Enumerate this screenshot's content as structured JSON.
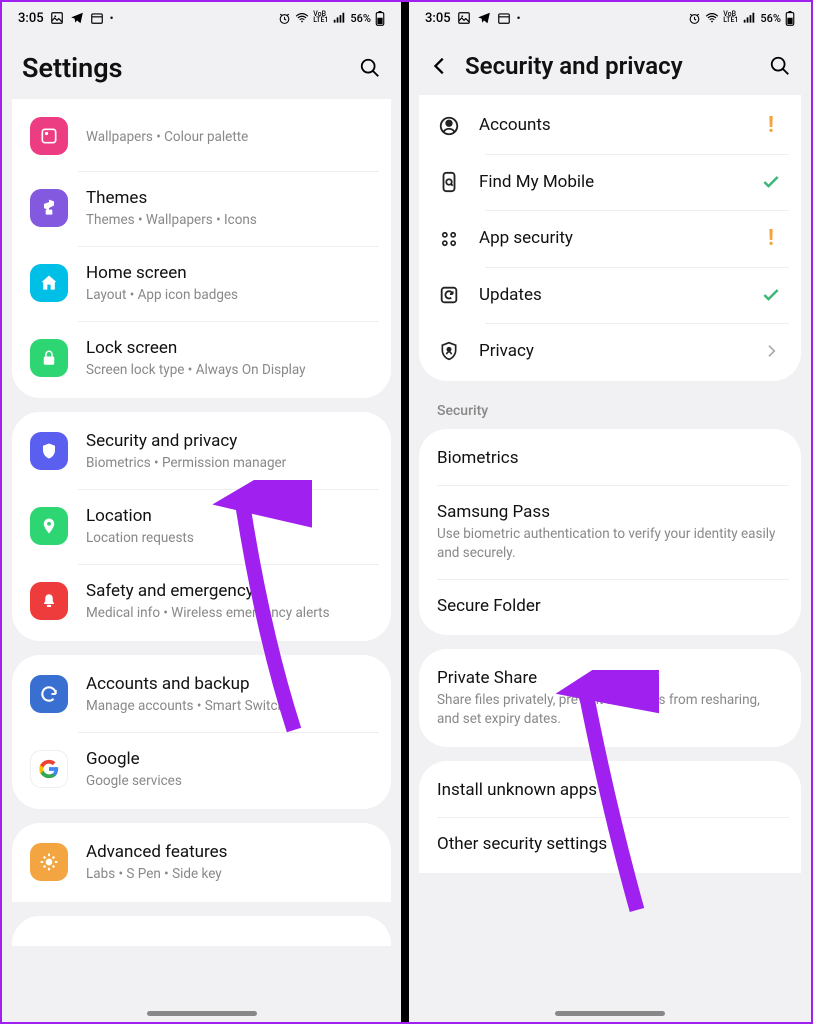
{
  "status_bar": {
    "time": "3:05",
    "battery": "56%"
  },
  "left": {
    "title": "Settings",
    "groups": [
      {
        "cut": "top",
        "items": [
          {
            "icon": "wallpaper-icon",
            "color": "#ec3d82",
            "title": "",
            "sub": "Wallpapers  •  Colour palette"
          },
          {
            "icon": "themes-icon",
            "color": "#8359e0",
            "title": "Themes",
            "sub": "Themes  •  Wallpapers  •  Icons"
          },
          {
            "icon": "home-icon",
            "color": "#00bfe6",
            "title": "Home screen",
            "sub": "Layout  •  App icon badges"
          },
          {
            "icon": "lock-icon",
            "color": "#2ed573",
            "title": "Lock screen",
            "sub": "Screen lock type  •  Always On Display"
          }
        ]
      },
      {
        "items": [
          {
            "icon": "shield-icon",
            "color": "#5b5ff0",
            "title": "Security and privacy",
            "sub": "Biometrics  •  Permission manager"
          },
          {
            "icon": "location-pin-icon",
            "color": "#2ed573",
            "title": "Location",
            "sub": "Location requests"
          },
          {
            "icon": "emergency-icon",
            "color": "#ee3c3c",
            "title": "Safety and emergency",
            "sub": "Medical info  •  Wireless emergency alerts"
          }
        ]
      },
      {
        "items": [
          {
            "icon": "sync-icon",
            "color": "#3a6fd2",
            "title": "Accounts and backup",
            "sub": "Manage accounts  •  Smart Switch"
          },
          {
            "icon": "google-icon",
            "color": "#ffffff",
            "title": "Google",
            "sub": "Google services"
          }
        ]
      },
      {
        "cut": "bottom",
        "items": [
          {
            "icon": "star-icon",
            "color": "#f2a540",
            "title": "Advanced features",
            "sub": "Labs  •  S Pen  •  Side key"
          }
        ]
      }
    ]
  },
  "right": {
    "title": "Security and privacy",
    "top_group": {
      "cut": "top",
      "items": [
        {
          "icon": "account-icon",
          "title": "Accounts",
          "tail": "alert"
        },
        {
          "icon": "find-phone-icon",
          "title": "Find My Mobile",
          "tail": "check"
        },
        {
          "icon": "grid-icon",
          "title": "App security",
          "tail": "alert"
        },
        {
          "icon": "update-icon",
          "title": "Updates",
          "tail": "check"
        },
        {
          "icon": "privacy-shield-icon",
          "title": "Privacy",
          "tail": "chev"
        }
      ]
    },
    "section_label": "Security",
    "sec_group1": {
      "items": [
        {
          "title": "Biometrics",
          "sub": ""
        },
        {
          "title": "Samsung Pass",
          "sub": "Use biometric authentication to verify your identity easily and securely."
        },
        {
          "title": "Secure Folder",
          "sub": ""
        }
      ]
    },
    "sec_group2": {
      "items": [
        {
          "title": "Private Share",
          "sub": "Share files privately, prevent recipients from resharing, and set expiry dates."
        }
      ]
    },
    "sec_group3": {
      "cut": "bottom",
      "items": [
        {
          "title": "Install unknown apps",
          "sub": ""
        },
        {
          "title": "Other security settings",
          "sub": ""
        }
      ]
    }
  }
}
